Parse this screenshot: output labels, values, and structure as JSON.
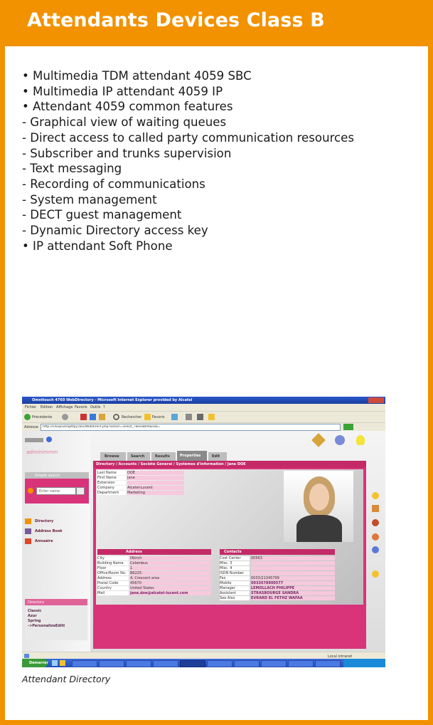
{
  "header": {
    "title": "Attendants Devices Class B"
  },
  "features": [
    "• Multimedia TDM attendant 4059 SBC",
    "• Multimedia IP attendant 4059 IP",
    "• Attendant 4059 common features",
    "- Graphical view of waiting queues",
    "- Direct access to called party communication resources",
    "- Subscriber and trunks supervision",
    "- Text messaging",
    "- Recording of communications",
    "- System management",
    "- DECT guest management",
    "- Dynamic Directory access key",
    "• IP attendant Soft Phone"
  ],
  "caption": "Attendant Directory",
  "screenshot": {
    "window_title": "Omnitouch 4760 WebDirectory - Microsoft Internet Explorer provided by Alcatel",
    "menu": [
      "Fichier",
      "Edition",
      "Affichage",
      "Favoris",
      "Outils",
      "?"
    ],
    "toolbar": [
      "Précédente",
      "Rechercher",
      "Favoris"
    ],
    "address_label": "Adresse",
    "address_value": "http://cduqcu0/opttpy.dev/Webdirect.php?action=select_?wexabhtwnob=",
    "logo": "adminimmm",
    "search_panel_title": "Simple search",
    "search_placeholder": "Enter name",
    "nav": [
      "Directory",
      "Address Book",
      "Annuaire"
    ],
    "tabs": [
      "Browse",
      "Search",
      "Results",
      "Properties",
      "Edit"
    ],
    "breadcrumb": "Directory / Accounts / Société Général / Systèmes d'information / Jane DOE",
    "ident_rows": [
      [
        "Last Name",
        "DOE"
      ],
      [
        "First Name",
        "Jane"
      ],
      [
        "Extension",
        ""
      ],
      [
        "Company",
        "Alcatel-Lucent"
      ],
      [
        "Department",
        "Marketing"
      ]
    ],
    "address_title": "Address",
    "address_rows": [
      [
        "City",
        "Illkirch"
      ],
      [
        "Building Name",
        "Colombus"
      ],
      [
        "Floor",
        "1"
      ],
      [
        "Office/Room No.",
        "B6225"
      ],
      [
        "Address",
        "4, Crescent area"
      ],
      [
        "Postal Code",
        "45670"
      ],
      [
        "Country",
        "United States"
      ],
      [
        "Mail",
        "jane.doe@alcatel-lucent.com"
      ]
    ],
    "contacts_title": "Contacts",
    "contacts_rows": [
      [
        "Cost Center",
        "00563"
      ],
      [
        "Misc. 3",
        ""
      ],
      [
        "Misc. 4",
        ""
      ],
      [
        "ISDN Number",
        ""
      ],
      [
        "Fax",
        "0033/21345799"
      ],
      [
        "Mobile",
        "0033678900577"
      ],
      [
        "Manager",
        "LEMOLLACH PHILIPPE"
      ],
      [
        "Assistant",
        "STRASBOURGE SANDRA"
      ],
      [
        "See Also",
        "EVRARD EL FETHZ WAFAA"
      ]
    ],
    "folders_title": "Directory",
    "folders": [
      "Classic",
      "Azur",
      "Spring",
      "->PersonalizeEditt"
    ],
    "status_right": "Local intranet",
    "taskbar_start": "Démarrer"
  },
  "colors": {
    "orange": "#f29200",
    "pink": "#d9347a",
    "light_pink": "#f6c9dc",
    "grey": "#c9c9c9"
  }
}
